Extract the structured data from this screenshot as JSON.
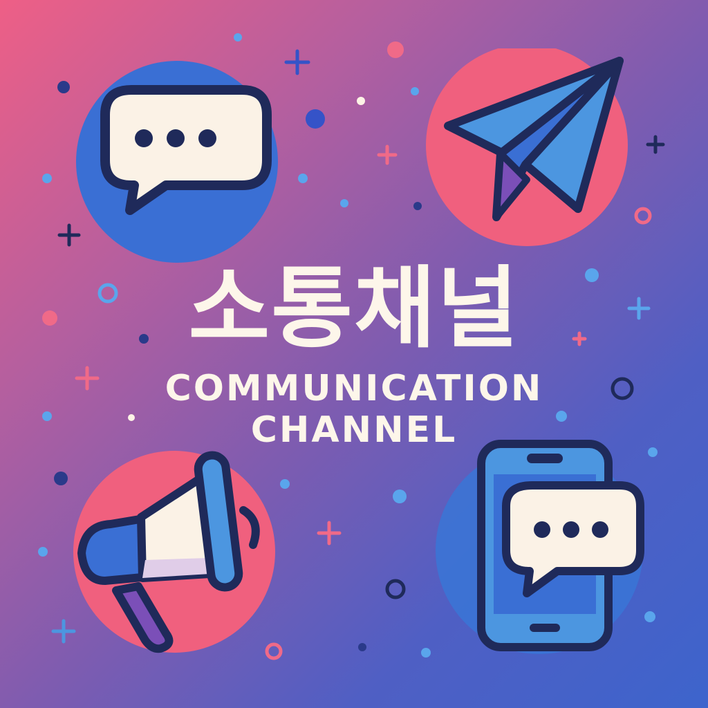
{
  "title": {
    "korean": "소통채널",
    "english_line1": "COMMUNICATION",
    "english_line2": "CHANNEL"
  },
  "icons": [
    {
      "name": "chat-bubble-icon"
    },
    {
      "name": "paper-plane-icon"
    },
    {
      "name": "megaphone-icon"
    },
    {
      "name": "mobile-chat-icon"
    }
  ],
  "colors": {
    "background_start": "#ee5f86",
    "background_end": "#3d64cc",
    "title_text": "#fdf6ea",
    "outline": "#1f2a5a",
    "blue_badge": "#3a6fd4",
    "pink_badge": "#f0607e",
    "light_blue": "#4c96e0",
    "cream": "#fbf2e6"
  }
}
